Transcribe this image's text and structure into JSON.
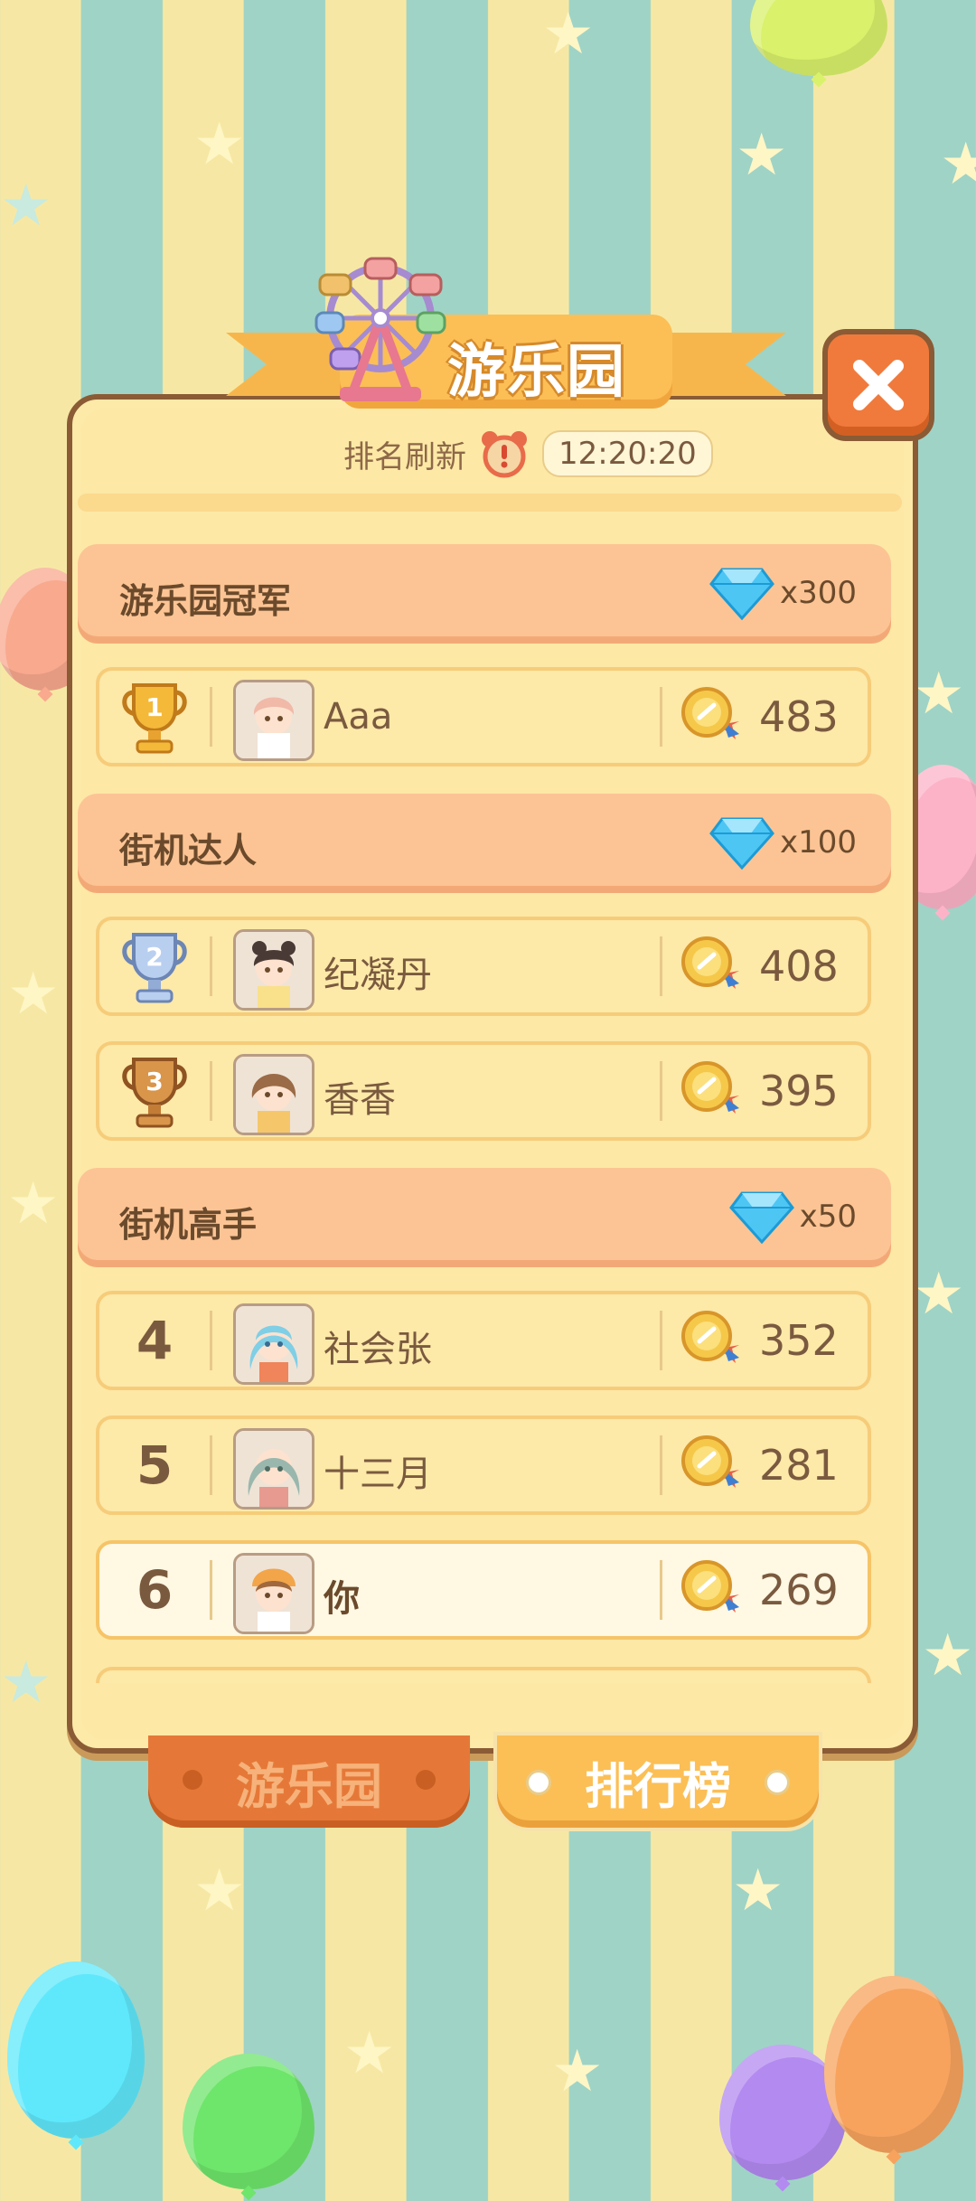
{
  "header": {
    "title": "游乐园",
    "refresh_label": "排名刷新",
    "timer": "12:20:20"
  },
  "sections": [
    {
      "title": "游乐园冠军",
      "reward": "x300"
    },
    {
      "title": "街机达人",
      "reward": "x100"
    },
    {
      "title": "街机高手",
      "reward": "x50"
    }
  ],
  "rows": [
    {
      "rank": "1",
      "name": "Aaa",
      "score": "483"
    },
    {
      "rank": "2",
      "name": "纪凝丹",
      "score": "408"
    },
    {
      "rank": "3",
      "name": "香香",
      "score": "395"
    },
    {
      "rank": "4",
      "name": "社会张",
      "score": "352"
    },
    {
      "rank": "5",
      "name": "十三月",
      "score": "281"
    },
    {
      "rank": "6",
      "name": "你",
      "score": "269"
    }
  ],
  "tabs": {
    "park": "游乐园",
    "ranking": "排行榜"
  },
  "icons": [
    "ferris-wheel-icon",
    "alarm-clock-icon",
    "diamond-icon",
    "trophy-gold-icon",
    "trophy-silver-icon",
    "trophy-bronze-icon",
    "medal-icon",
    "close-icon"
  ],
  "colors": {
    "accent": "#fbbf56",
    "close": "#f07a3c",
    "panel": "#fde9a8",
    "section": "#fcc494"
  }
}
